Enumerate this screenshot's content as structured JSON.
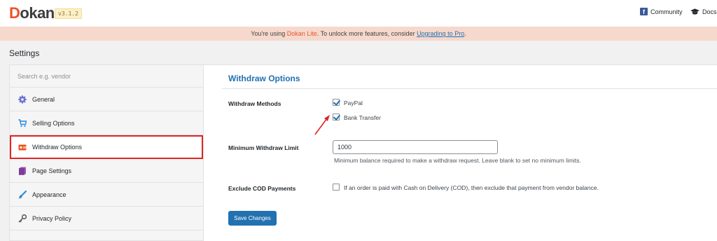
{
  "header": {
    "brand_first": "D",
    "brand_rest": "okan",
    "version": "v3.1.2",
    "community_label": "Community",
    "docs_label": "Docs"
  },
  "notice": {
    "prefix": "You're using ",
    "product": "Dokan Lite",
    "middle": ". To unlock more features, consider ",
    "link": "Upgrading to Pro",
    "suffix": "."
  },
  "page": {
    "title": "Settings"
  },
  "sidebar": {
    "search_placeholder": "Search e.g. vendor",
    "items": [
      {
        "label": "General",
        "icon": "gear-icon",
        "active": false
      },
      {
        "label": "Selling Options",
        "icon": "cart-icon",
        "active": false
      },
      {
        "label": "Withdraw Options",
        "icon": "withdraw-icon",
        "active": true
      },
      {
        "label": "Page Settings",
        "icon": "page-icon",
        "active": false
      },
      {
        "label": "Appearance",
        "icon": "brush-icon",
        "active": false
      },
      {
        "label": "Privacy Policy",
        "icon": "key-icon",
        "active": false
      }
    ]
  },
  "panel": {
    "title": "Withdraw Options",
    "withdraw_methods": {
      "label": "Withdraw Methods",
      "options": [
        {
          "label": "PayPal",
          "checked": true
        },
        {
          "label": "Bank Transfer",
          "checked": true
        }
      ]
    },
    "min_limit": {
      "label": "Minimum Withdraw Limit",
      "value": "1000",
      "help": "Minimum balance required to make a withdraw request. Leave blank to set no minimum limits."
    },
    "exclude_cod": {
      "label": "Exclude COD Payments",
      "checked": false,
      "text": "If an order is paid with Cash on Delivery (COD), then exclude that payment from vendor balance."
    },
    "save_label": "Save Changes"
  },
  "colors": {
    "accent": "#2271b1",
    "brand": "#f05025",
    "notice_bg": "#f6d8cc",
    "highlight": "#e02424"
  }
}
